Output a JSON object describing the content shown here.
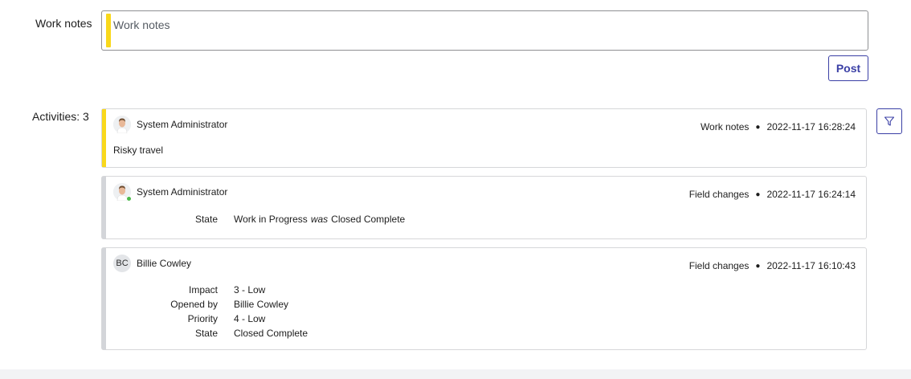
{
  "work_notes": {
    "label": "Work notes",
    "placeholder": "Work notes",
    "indicator_color": "#f9d81b"
  },
  "post_button": {
    "label": "Post"
  },
  "activities": {
    "label": "Activities: 3",
    "filter_icon": "filter-icon",
    "entries": [
      {
        "author": "System Administrator",
        "avatar": "photo",
        "type": "Work notes",
        "timestamp": "2022-11-17 16:28:24",
        "text": "Risky travel",
        "stripe_color": "#f9d81b"
      },
      {
        "author": "System Administrator",
        "avatar": "photo",
        "online": true,
        "type": "Field changes",
        "timestamp": "2022-11-17 16:24:14",
        "changes": [
          {
            "field": "State",
            "value": "Work in Progress",
            "was_label": "was",
            "previous": "Closed Complete"
          }
        ],
        "stripe_color": "#d3d5d9"
      },
      {
        "author": "Billie Cowley",
        "avatar_initials": "BC",
        "type": "Field changes",
        "timestamp": "2022-11-17 16:10:43",
        "changes": [
          {
            "field": "Impact",
            "value": "3 - Low"
          },
          {
            "field": "Opened by",
            "value": "Billie Cowley"
          },
          {
            "field": "Priority",
            "value": "4 - Low"
          },
          {
            "field": "State",
            "value": "Closed Complete"
          }
        ],
        "stripe_color": "#d3d5d9"
      }
    ]
  },
  "colors": {
    "accent": "#3a3fa5",
    "work_note_yellow": "#f9d81b",
    "field_change_grey": "#d3d5d9",
    "online_green": "#4cba4c"
  }
}
